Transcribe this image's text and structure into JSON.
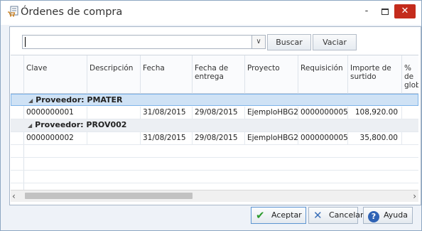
{
  "window": {
    "title": "Órdenes de compra",
    "icon": "purchase-order-icon",
    "controls": {
      "minimize": "-",
      "maximize": "□",
      "close": "✕"
    }
  },
  "search": {
    "value": "",
    "placeholder": ""
  },
  "toolbar": {
    "buscar_label": "Buscar",
    "vaciar_label": "Vaciar"
  },
  "grid": {
    "columns": [
      "Clave",
      "Descripción",
      "Fecha",
      "Fecha de entrega",
      "Proyecto",
      "Requisición",
      "Importe de surtido",
      "% de glob"
    ],
    "groups": [
      {
        "label": "Proveedor: PMATER",
        "rows": [
          {
            "clave": "0000000001",
            "descripcion": "",
            "fecha": "31/08/2015",
            "fecha_entrega": "29/08/2015",
            "proyecto": "EjemploHBG2",
            "requisicion": "0000000005",
            "importe": "108,920.00"
          }
        ]
      },
      {
        "label": "Proveedor: PROV002",
        "rows": [
          {
            "clave": "0000000002",
            "descripcion": "",
            "fecha": "31/08/2015",
            "fecha_entrega": "29/08/2015",
            "proyecto": "EjemploHBG2",
            "requisicion": "0000000005",
            "importe": "35,800.00"
          }
        ]
      }
    ]
  },
  "footer": {
    "aceptar_label": "Aceptar",
    "cancelar_label": "Cancelar",
    "ayuda_label": "Ayuda"
  },
  "colors": {
    "accent": "#2f63b5",
    "close_button": "#c42b1c",
    "group_highlight": "#cfe2f5",
    "accept_icon": "#2d9b2d"
  }
}
